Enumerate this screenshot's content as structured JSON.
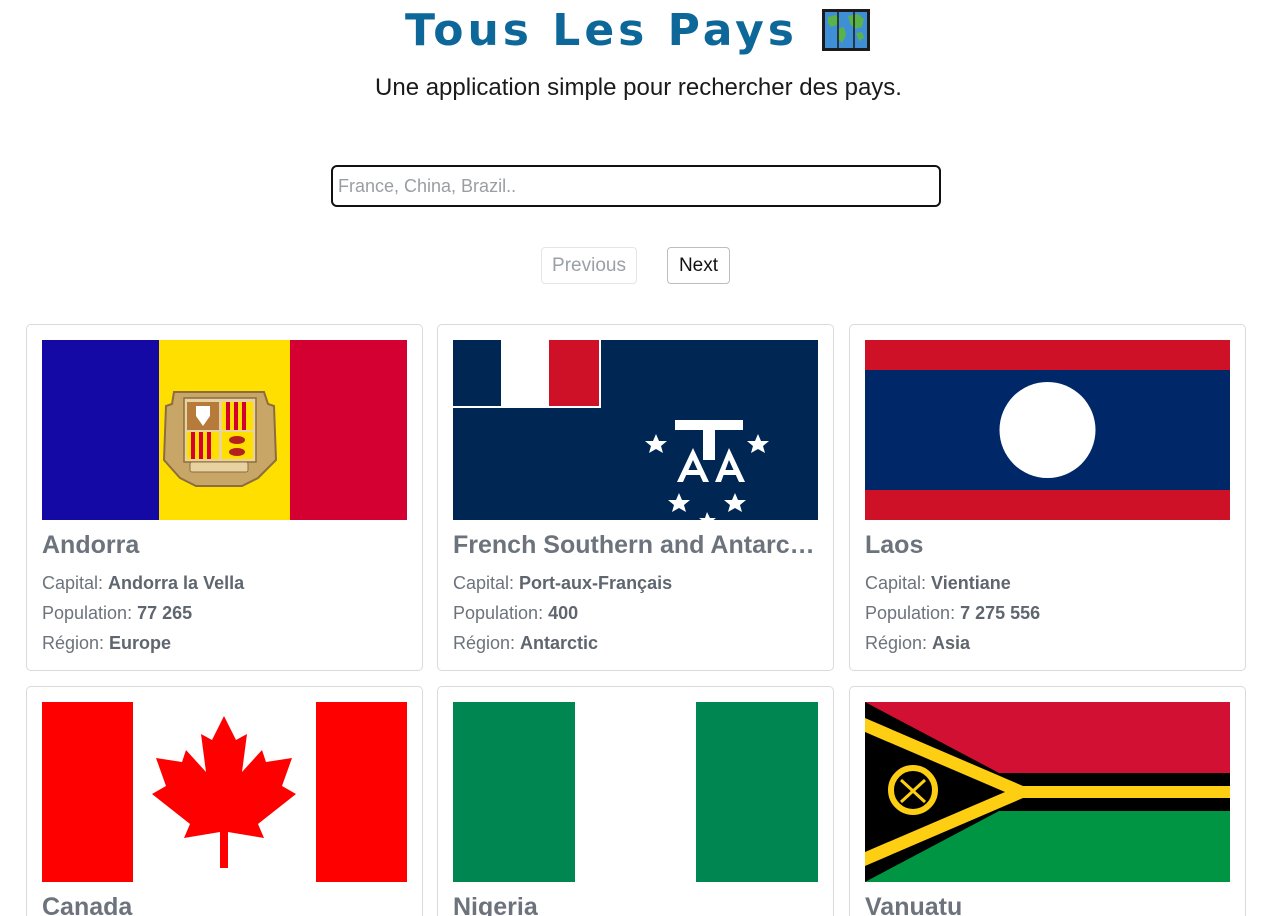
{
  "header": {
    "title": "Tous Les Pays",
    "subtitle": "Une application simple pour rechercher des pays."
  },
  "search": {
    "placeholder": "France, China, Brazil..",
    "value": ""
  },
  "pagination": {
    "previous_label": "Previous",
    "next_label": "Next",
    "previous_disabled": true
  },
  "labels": {
    "capital": "Capital: ",
    "population": "Population: ",
    "region": "Région: "
  },
  "countries": [
    {
      "name": "Andorra",
      "capital": "Andorra la Vella",
      "population": "77 265",
      "region": "Europe",
      "flag": "andorra-flag"
    },
    {
      "name": "French Southern and Antarctic Lands",
      "capital": "Port-aux-Français",
      "population": "400",
      "region": "Antarctic",
      "flag": "french-southern-flag"
    },
    {
      "name": "Laos",
      "capital": "Vientiane",
      "population": "7 275 556",
      "region": "Asia",
      "flag": "laos-flag"
    },
    {
      "name": "Canada",
      "flag": "canada-flag"
    },
    {
      "name": "Nigeria",
      "flag": "nigeria-flag"
    },
    {
      "name": "Vanuatu",
      "flag": "vanuatu-flag"
    }
  ],
  "colors": {
    "title": "#0d6799",
    "muted_text": "#6c737c"
  },
  "icons": {
    "title_emoji": "world-map-icon"
  }
}
